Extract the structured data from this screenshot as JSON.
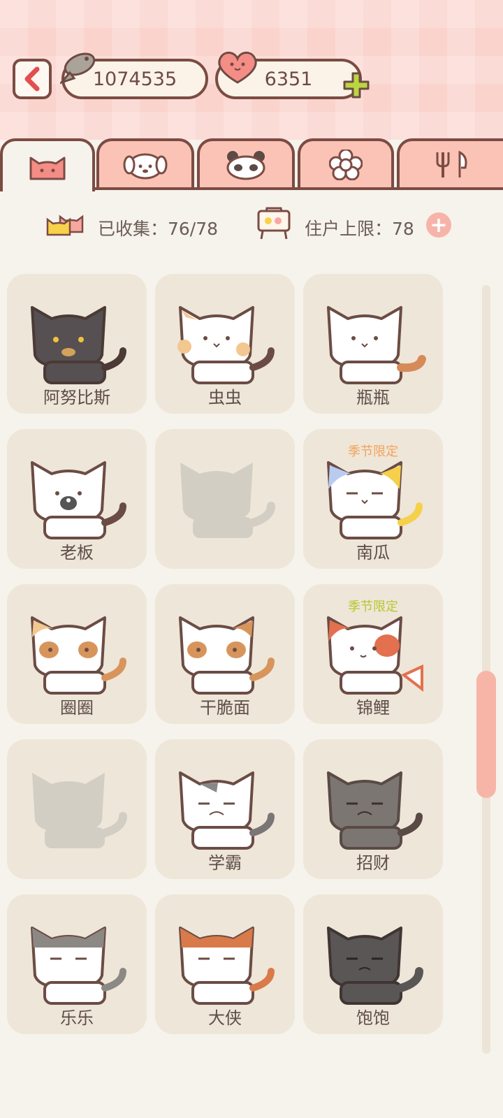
{
  "header": {
    "fish_count": "1074535",
    "heart_count": "6351"
  },
  "stats": {
    "collected": "已收集：76/78",
    "limit": "住户上限：78"
  },
  "cats": [
    {
      "name": "阿努比斯",
      "badge": ""
    },
    {
      "name": "虫虫",
      "badge": ""
    },
    {
      "name": "瓶瓶",
      "badge": ""
    },
    {
      "name": "老板",
      "badge": ""
    },
    {
      "name": "",
      "badge": ""
    },
    {
      "name": "南瓜",
      "badge": "季节限定"
    },
    {
      "name": "圈圈",
      "badge": ""
    },
    {
      "name": "干脆面",
      "badge": ""
    },
    {
      "name": "锦鲤",
      "badge": "季节限定"
    },
    {
      "name": "",
      "badge": ""
    },
    {
      "name": "学霸",
      "badge": ""
    },
    {
      "name": "招财",
      "badge": ""
    },
    {
      "name": "乐乐",
      "badge": ""
    },
    {
      "name": "大侠",
      "badge": ""
    },
    {
      "name": "饱饱",
      "badge": ""
    }
  ],
  "colors": {
    "accent": "#7b4c43",
    "header_bg": "#fad3cd",
    "tab_bg": "#fbc3b6",
    "card_bg": "#eee6d8",
    "badge_orange": "#f2a35a",
    "badge_green": "#b9c531"
  }
}
